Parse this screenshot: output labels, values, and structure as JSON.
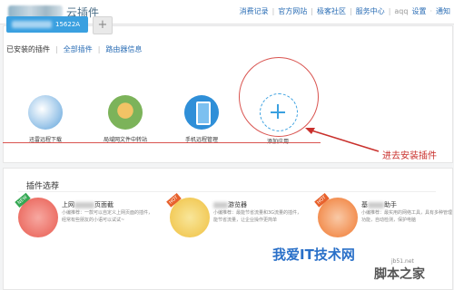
{
  "header": {
    "app_title": "云插件",
    "nav": [
      "消费记录",
      "官方网站",
      "极客社区",
      "服务中心"
    ],
    "user": "aqq",
    "settings": "设置",
    "notify": "通知"
  },
  "router": {
    "id_suffix": "15622A",
    "add_symbol": "+"
  },
  "subnav": {
    "active": "已安装的插件",
    "links": [
      "全部插件",
      "路由器信息"
    ]
  },
  "installed": [
    {
      "label": "迅雷远程下载",
      "color": "#5aa0d8"
    },
    {
      "label": "局域网文件中转站",
      "color": "#7cb35a"
    },
    {
      "label": "手机远程管理",
      "color": "#2f8fd8"
    }
  ],
  "add_app": {
    "label": "添加应用",
    "symbol": "+"
  },
  "annotation": {
    "text": "进去安装插件",
    "color": "#c9302c"
  },
  "recommend": {
    "title": "插件选荐",
    "items": [
      {
        "name_prefix": "上网",
        "name_suffix": "页面截",
        "badge": "NEW",
        "desc": "小编推荐：一款可以自定义上网页面的插件，经常有些朋友的小语可以试试~",
        "color": "#e85a4f"
      },
      {
        "name_prefix": "",
        "name_suffix": "游览器",
        "badge": "HOT",
        "desc": "小编推荐：最能节省流量和3G流量的插件，能节省流量，让企业操作更简单",
        "color": "#f0c040"
      },
      {
        "name_prefix": "基",
        "name_suffix": "助手",
        "badge": "HOT",
        "desc": "小编推荐：最实用的网络工具，具有多种管理功能，自动检测，保护电脑",
        "color": "#f07830"
      }
    ]
  },
  "watermark": {
    "main": "我爱IT技术网",
    "site": "脚本之家",
    "domain": "jb51.net"
  }
}
